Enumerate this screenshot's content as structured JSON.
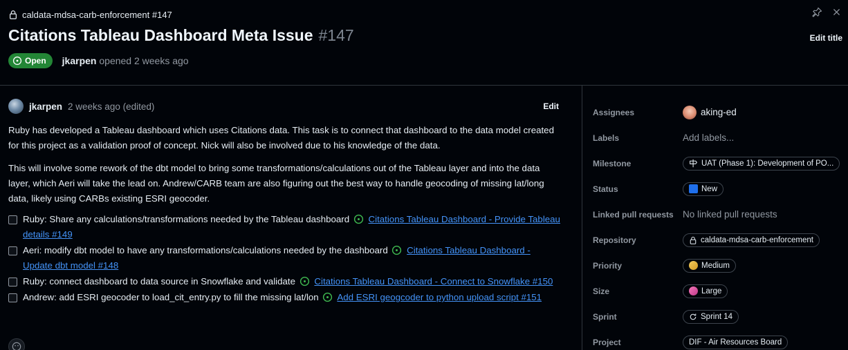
{
  "header": {
    "repo_ref": "caldata-mdsa-carb-enforcement #147",
    "title": "Citations Tableau Dashboard Meta Issue",
    "number": "#147",
    "edit_title": "Edit title",
    "state": "Open",
    "author": "jkarpen",
    "opened_text": "opened 2 weeks ago"
  },
  "comment": {
    "author": "jkarpen",
    "meta": "2 weeks ago (edited)",
    "edit_label": "Edit",
    "paragraphs": [
      "Ruby has developed a Tableau dashboard which uses Citations data. This task is to connect that dashboard to the data model created for this project as a validation proof of concept. Nick will also be involved due to his knowledge of the data.",
      "This will involve some rework of the dbt model to bring some transformations/calculations out of the Tableau layer and into the data layer, which Aeri will take the lead on. Andrew/CARB team are also figuring out the best way to handle geocoding of missing lat/long data, likely using CARBs existing ESRI geocoder."
    ],
    "tasks": [
      {
        "text": "Ruby: Share any calculations/transformations needed by the Tableau dashboard",
        "link": "Citations Tableau Dashboard - Provide Tableau details #149"
      },
      {
        "text": "Aeri: modify dbt model to have any transformations/calculations needed by the dashboard",
        "link": "Citations Tableau Dashboard - Update dbt model #148"
      },
      {
        "text": "Ruby: connect dashboard to data source in Snowflake and validate",
        "link": "Citations Tableau Dashboard - Connect to Snowflake #150"
      },
      {
        "text": "Andrew: add ESRI geocoder to load_cit_entry.py to fill the missing lat/lon",
        "link": "Add ESRI geogcoder to python upload script #151"
      }
    ]
  },
  "sidebar": {
    "assignees_label": "Assignees",
    "assignee": "aking-ed",
    "labels_label": "Labels",
    "labels_value": "Add labels...",
    "milestone_label": "Milestone",
    "milestone_value": "UAT (Phase 1): Development of PO...",
    "status_label": "Status",
    "status_value": "New",
    "linked_label": "Linked pull requests",
    "linked_value": "No linked pull requests",
    "repository_label": "Repository",
    "repository_value": "caldata-mdsa-carb-enforcement",
    "priority_label": "Priority",
    "priority_value": "Medium",
    "size_label": "Size",
    "size_value": "Large",
    "sprint_label": "Sprint",
    "sprint_value": "Sprint 14",
    "project_label": "Project",
    "project_value": "DIF - Air Resources Board"
  },
  "colors": {
    "background": "#010409",
    "open_green": "#238636",
    "link_blue": "#4493f8",
    "muted": "#9198a1",
    "border": "#30363d"
  }
}
